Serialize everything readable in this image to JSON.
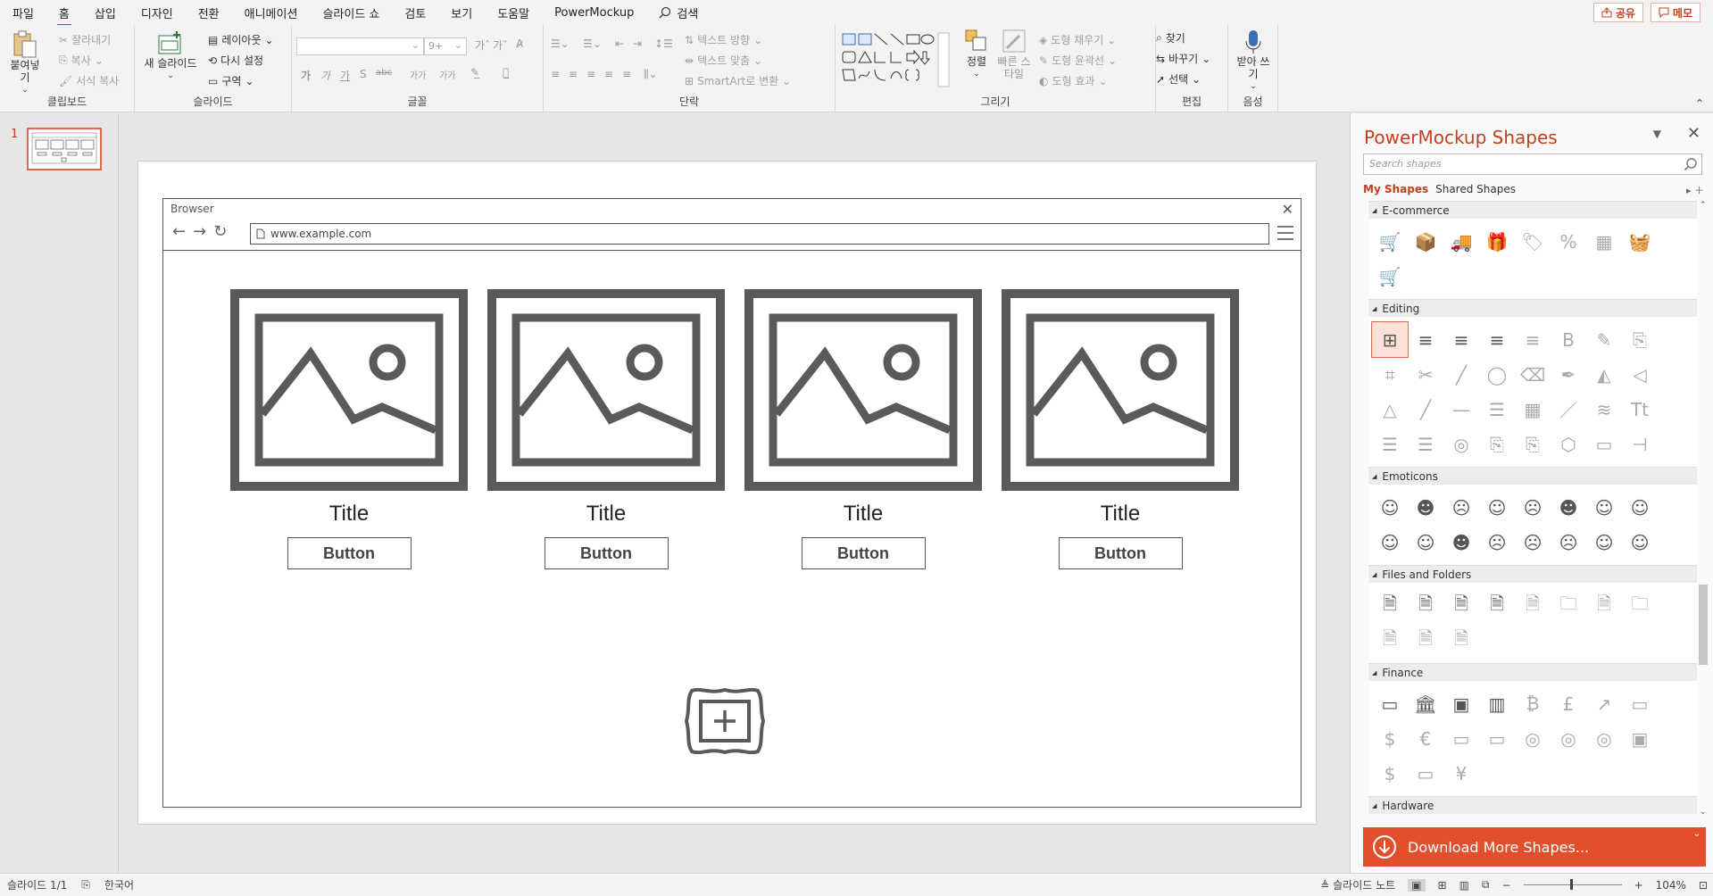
{
  "menu": [
    "파일",
    "홈",
    "삽입",
    "디자인",
    "전환",
    "애니메이션",
    "슬라이드 쇼",
    "검토",
    "보기",
    "도움말",
    "PowerMockup"
  ],
  "search_label": "검색",
  "share_label": "공유",
  "memo_label": "메모",
  "ribbon": {
    "clipboard": {
      "label": "클립보드",
      "paste": "붙여넣기",
      "cut": "잘라내기",
      "copy": "복사",
      "format_painter": "서식 복사"
    },
    "slides": {
      "label": "슬라이드",
      "new_slide": "새 슬라이드",
      "layout": "레이아웃",
      "reset": "다시 설정",
      "section": "구역"
    },
    "font": {
      "label": "글꼴",
      "size": "9+",
      "bold": "가",
      "italic": "가",
      "underline": "가",
      "shadow": "S",
      "strike": "abc",
      "spacing": "가가",
      "case": "가가"
    },
    "paragraph": {
      "label": "단락",
      "text_direction": "텍스트 방향",
      "align_text": "텍스트 맞춤",
      "smartart": "SmartArt로 변환"
    },
    "drawing": {
      "label": "그리기",
      "arrange": "정렬",
      "quick_styles": "빠른 스타일",
      "shape_fill": "도형 채우기",
      "shape_outline": "도형 윤곽선",
      "shape_effects": "도형 효과"
    },
    "editing": {
      "label": "편집",
      "find": "찾기",
      "replace": "바꾸기",
      "select": "선택"
    },
    "voice": {
      "label": "음성",
      "dictate": "받아 쓰기"
    }
  },
  "thumbnail_number": "1",
  "slide": {
    "browser_title": "Browser",
    "url": "www.example.com",
    "cards": [
      {
        "title": "Title",
        "button": "Button"
      },
      {
        "title": "Title",
        "button": "Button"
      },
      {
        "title": "Title",
        "button": "Button"
      },
      {
        "title": "Title",
        "button": "Button"
      }
    ]
  },
  "pane": {
    "title": "PowerMockup Shapes",
    "search_placeholder": "Search shapes",
    "tab_my": "My Shapes",
    "tab_shared": "Shared Shapes",
    "sections": [
      {
        "name": "E-commerce",
        "count": 9
      },
      {
        "name": "Editing",
        "count": 32
      },
      {
        "name": "Emoticons",
        "count": 16
      },
      {
        "name": "Files and Folders",
        "count": 11
      },
      {
        "name": "Finance",
        "count": 19
      },
      {
        "name": "Hardware",
        "count": 0
      }
    ],
    "download": "Download More Shapes..."
  },
  "status": {
    "slide_info": "슬라이드 1/1",
    "language": "한국어",
    "notes": "슬라이드 노트",
    "zoom": "104%"
  },
  "colors": {
    "accent": "#c43e1c",
    "download_bg": "#e14f2d",
    "wire": "#5a5a5a"
  }
}
